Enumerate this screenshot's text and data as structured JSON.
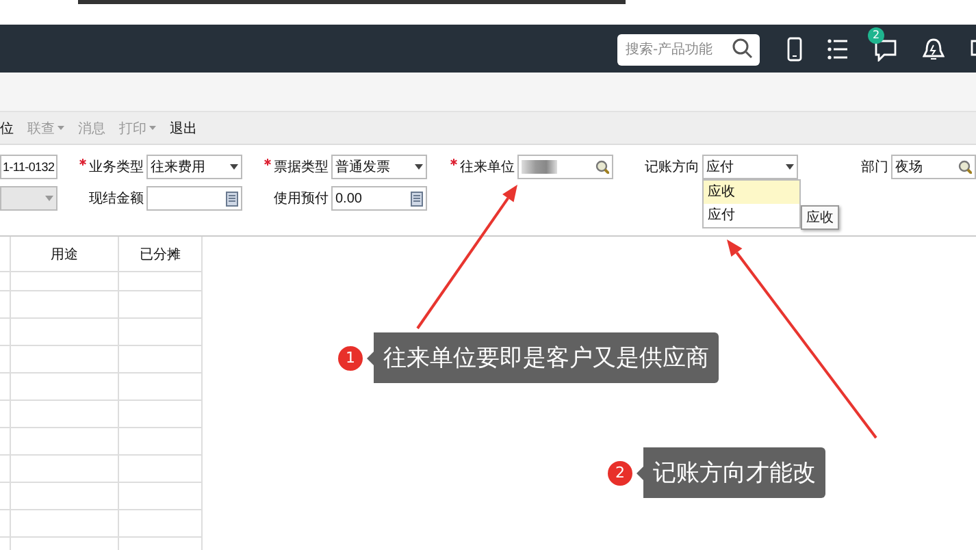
{
  "top_bar": {
    "search": {
      "placeholder": "搜索-产品功能"
    },
    "notification_badge": "2"
  },
  "toolbar": {
    "items": [
      {
        "label": "位",
        "dropdown": false,
        "disabled": false
      },
      {
        "label": "联查",
        "dropdown": true,
        "disabled": true
      },
      {
        "label": "消息",
        "dropdown": false,
        "disabled": true
      },
      {
        "label": "打印",
        "dropdown": true,
        "disabled": true
      },
      {
        "label": "退出",
        "dropdown": false,
        "disabled": false
      }
    ]
  },
  "form": {
    "rows": [
      [
        {
          "kind": "text",
          "value": "1-11-0132"
        },
        {
          "kind": "select",
          "label": "业务类型",
          "required": true,
          "value": "往来费用"
        },
        {
          "kind": "select",
          "label": "票据类型",
          "required": true,
          "value": "普通发票"
        },
        {
          "kind": "lookup",
          "label": "往来单位",
          "required": true,
          "redacted": true
        },
        {
          "kind": "select",
          "label": "记账方向",
          "required": false,
          "value": "应付",
          "open": true,
          "tooltip": "应收",
          "options": [
            {
              "label": "应收",
              "highlighted": true
            },
            {
              "label": "应付",
              "highlighted": false
            }
          ]
        },
        {
          "kind": "lookup",
          "label": "部门",
          "required": false,
          "value": "夜场"
        }
      ],
      [
        {
          "kind": "select",
          "disabled": true
        },
        {
          "kind": "amount",
          "label": "现结金额",
          "required": false
        },
        {
          "kind": "amount",
          "label": "使用预付",
          "required": false,
          "value": "0.00"
        }
      ]
    ]
  },
  "table": {
    "columns": [
      "用途",
      "已分摊"
    ]
  },
  "annotations": [
    {
      "number": "1",
      "text": "往来单位要即是客户又是供应商"
    },
    {
      "number": "2",
      "text": "记账方向才能改"
    }
  ]
}
